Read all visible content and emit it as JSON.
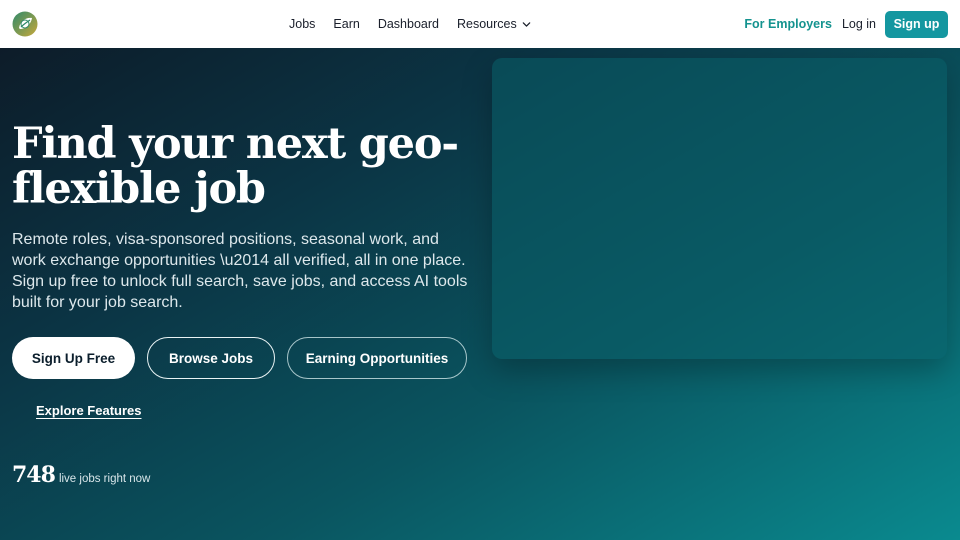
{
  "nav": {
    "logo_icon": "leaf-globe-icon",
    "links": [
      "Jobs",
      "Earn",
      "Dashboard",
      "Resources"
    ],
    "resources_icon": "chevron-down-icon",
    "employers": "For Employers",
    "login": "Log in",
    "signup": "Sign up"
  },
  "hero": {
    "title_line1": "Find your next geo-",
    "title_line2": "flexible job",
    "subtitle": "Remote roles, visa-sponsored positions, seasonal work, and work exchange opportunities \\u2014 all verified, all in one place. Sign up free to unlock full search, save jobs, and access AI tools built for your job search.",
    "buttons": {
      "signup_free": "Sign Up Free",
      "browse": "Browse Jobs",
      "earning": "Earning Opportunities"
    },
    "explore": "Explore Features",
    "stats": {
      "count": "748",
      "label": "live jobs right now"
    }
  },
  "colors": {
    "accent": "#1497a0",
    "employers_text": "#14938f",
    "hero_dark": "#0d1c29",
    "hero_teal": "#0a8a8f"
  }
}
